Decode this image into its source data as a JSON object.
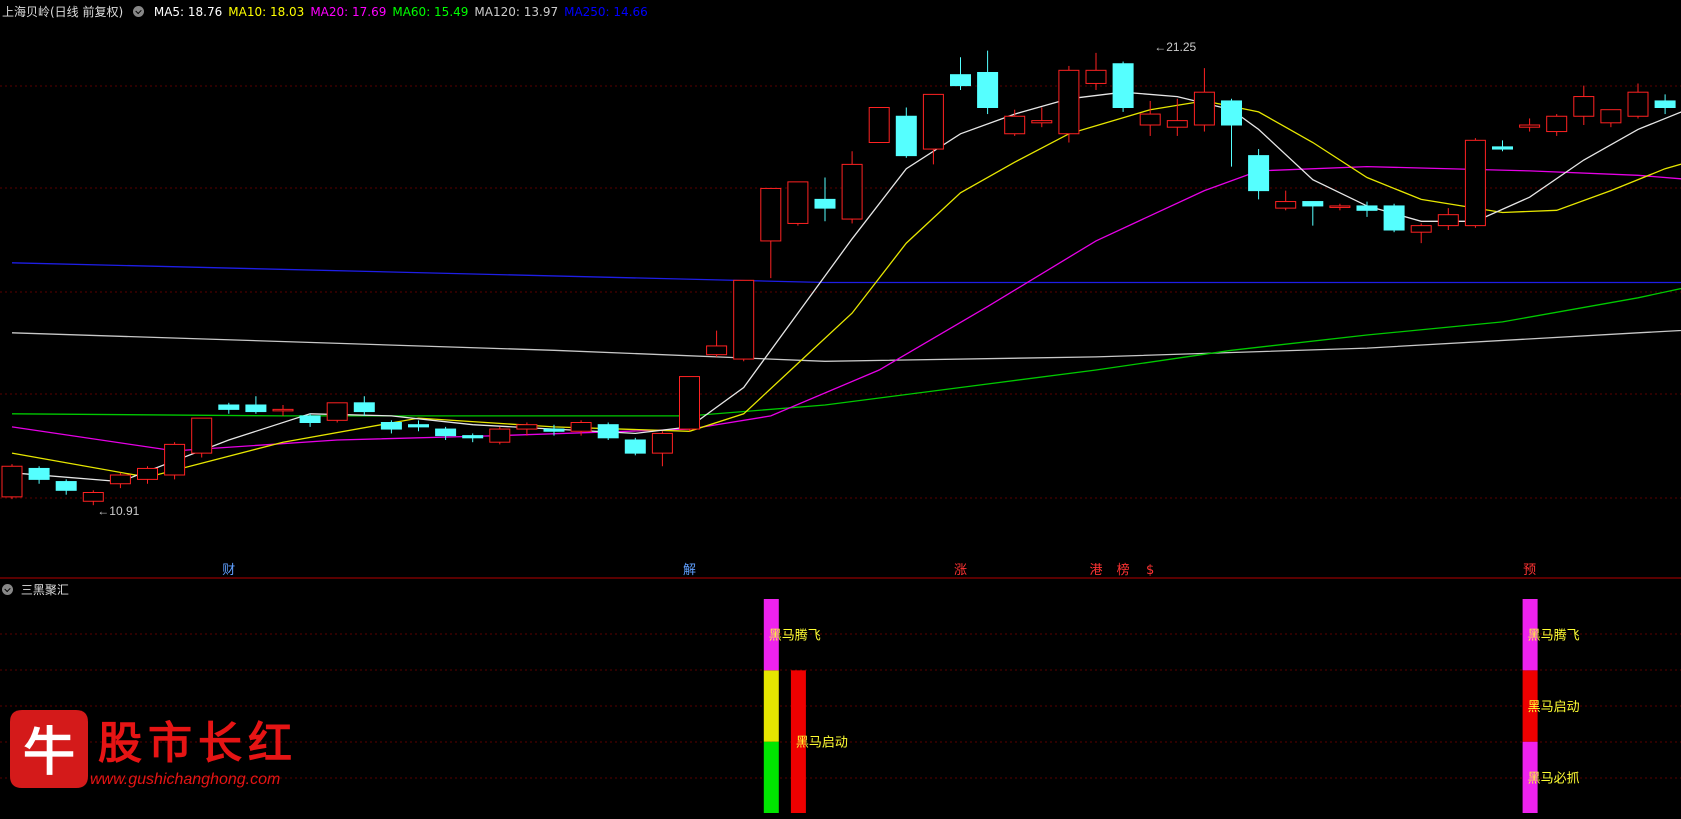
{
  "header": {
    "title": "上海贝岭(日线 前复权)",
    "ma_labels": [
      {
        "text": "MA5: 18.76",
        "color": "#ffffff"
      },
      {
        "text": "MA10: 18.03",
        "color": "#ffff00"
      },
      {
        "text": "MA20: 17.69",
        "color": "#ff00ff"
      },
      {
        "text": "MA60: 15.49",
        "color": "#00ff00"
      },
      {
        "text": "MA120: 13.97",
        "color": "#cccccc"
      },
      {
        "text": "MA250: 14.66",
        "color": "#0000ff"
      }
    ]
  },
  "subchart_title": "三黑聚汇",
  "logo": {
    "brand": "股市长红",
    "glyph": "牛",
    "url": "www.gushichanghong.com"
  },
  "chart_data": {
    "type": "candlestick",
    "price_range": [
      10,
      22
    ],
    "colors": {
      "up": "#ff2222",
      "down": "#55ffff",
      "ma5": "#e6e6e6",
      "ma10": "#e6e600",
      "ma20": "#e600e6",
      "ma60": "#00c800",
      "ma120": "#c8c8c8",
      "ma250": "#1e1ee6"
    },
    "candles": [
      [
        11.1,
        11.8,
        11.05,
        11.85
      ],
      [
        11.75,
        11.5,
        11.4,
        11.8
      ],
      [
        11.45,
        11.25,
        11.15,
        11.5
      ],
      [
        11.0,
        11.2,
        10.91,
        11.25
      ],
      [
        11.4,
        11.6,
        11.3,
        11.65
      ],
      [
        11.5,
        11.75,
        11.4,
        11.8
      ],
      [
        11.6,
        12.3,
        11.5,
        12.35
      ],
      [
        12.1,
        12.9,
        12.0,
        12.9
      ],
      [
        13.2,
        13.1,
        13.0,
        13.25
      ],
      [
        13.2,
        13.05,
        13.0,
        13.4
      ],
      [
        13.1,
        13.1,
        12.95,
        13.2
      ],
      [
        12.95,
        12.8,
        12.7,
        13.0
      ],
      [
        12.85,
        13.25,
        12.8,
        13.25
      ],
      [
        13.25,
        13.05,
        12.95,
        13.4
      ],
      [
        12.8,
        12.65,
        12.55,
        12.85
      ],
      [
        12.75,
        12.7,
        12.6,
        12.85
      ],
      [
        12.65,
        12.5,
        12.4,
        12.7
      ],
      [
        12.5,
        12.45,
        12.35,
        12.55
      ],
      [
        12.35,
        12.65,
        12.3,
        12.7
      ],
      [
        12.65,
        12.75,
        12.5,
        12.8
      ],
      [
        12.65,
        12.6,
        12.5,
        12.75
      ],
      [
        12.6,
        12.8,
        12.5,
        12.85
      ],
      [
        12.75,
        12.45,
        12.4,
        12.8
      ],
      [
        12.4,
        12.1,
        12.05,
        12.45
      ],
      [
        12.1,
        12.55,
        11.8,
        12.6
      ],
      [
        12.65,
        13.85,
        12.6,
        13.85
      ],
      [
        14.35,
        14.55,
        14.3,
        14.9
      ],
      [
        14.25,
        16.05,
        14.2,
        16.05
      ],
      [
        16.95,
        18.15,
        16.1,
        18.15
      ],
      [
        17.35,
        18.3,
        17.3,
        18.3
      ],
      [
        17.9,
        17.7,
        17.4,
        18.4
      ],
      [
        17.45,
        18.7,
        17.35,
        19.0
      ],
      [
        19.2,
        20.0,
        19.2,
        20.0
      ],
      [
        19.8,
        18.9,
        18.85,
        20.0
      ],
      [
        19.05,
        20.3,
        18.7,
        20.3
      ],
      [
        20.75,
        20.5,
        20.4,
        21.15
      ],
      [
        20.8,
        20.0,
        19.85,
        21.3
      ],
      [
        19.4,
        19.8,
        19.35,
        19.95
      ],
      [
        19.65,
        19.7,
        19.55,
        20.0
      ],
      [
        19.4,
        20.85,
        19.2,
        20.95
      ],
      [
        20.55,
        20.85,
        20.4,
        21.25
      ],
      [
        21.0,
        20.0,
        19.9,
        21.05
      ],
      [
        19.6,
        19.85,
        19.35,
        20.15
      ],
      [
        19.55,
        19.7,
        19.35,
        20.2
      ],
      [
        19.6,
        20.35,
        19.45,
        20.9
      ],
      [
        20.15,
        19.6,
        18.65,
        20.2
      ],
      [
        18.9,
        18.1,
        17.9,
        19.05
      ],
      [
        17.7,
        17.85,
        17.65,
        18.1
      ],
      [
        17.85,
        17.75,
        17.3,
        17.85
      ],
      [
        17.75,
        17.75,
        17.65,
        17.8
      ],
      [
        17.75,
        17.65,
        17.5,
        17.85
      ],
      [
        17.75,
        17.2,
        17.15,
        17.8
      ],
      [
        17.15,
        17.3,
        16.9,
        17.35
      ],
      [
        17.3,
        17.55,
        17.2,
        17.7
      ],
      [
        17.3,
        19.25,
        17.25,
        19.3
      ],
      [
        19.1,
        19.05,
        19.0,
        19.25
      ],
      [
        19.55,
        19.6,
        19.45,
        19.75
      ],
      [
        19.45,
        19.8,
        19.35,
        19.85
      ],
      [
        19.8,
        20.25,
        19.6,
        20.5
      ],
      [
        19.65,
        19.95,
        19.55,
        19.95
      ],
      [
        19.8,
        20.35,
        19.75,
        20.55
      ],
      [
        20.15,
        20.0,
        19.85,
        20.3
      ]
    ],
    "ma120_series": [
      [
        0,
        14.85
      ],
      [
        20,
        14.45
      ],
      [
        30,
        14.2
      ],
      [
        40,
        14.3
      ],
      [
        50,
        14.5
      ],
      [
        60,
        14.85
      ],
      [
        63,
        14.95
      ]
    ],
    "ma250_series": [
      [
        0,
        16.45
      ],
      [
        30,
        16.0
      ],
      [
        40,
        16.0
      ],
      [
        50,
        16.0
      ],
      [
        63,
        16.0
      ]
    ],
    "ma60_series": [
      [
        0,
        13.0
      ],
      [
        10,
        12.95
      ],
      [
        25,
        12.95
      ],
      [
        30,
        13.2
      ],
      [
        35,
        13.6
      ],
      [
        40,
        14.0
      ],
      [
        45,
        14.45
      ],
      [
        50,
        14.8
      ],
      [
        55,
        15.1
      ],
      [
        60,
        15.65
      ],
      [
        63,
        16.05
      ]
    ],
    "ma20_series": [
      [
        0,
        12.7
      ],
      [
        6,
        12.15
      ],
      [
        12,
        12.4
      ],
      [
        18,
        12.5
      ],
      [
        25,
        12.65
      ],
      [
        28,
        12.95
      ],
      [
        32,
        14.0
      ],
      [
        36,
        15.45
      ],
      [
        40,
        16.95
      ],
      [
        44,
        18.1
      ],
      [
        46,
        18.55
      ],
      [
        50,
        18.65
      ],
      [
        56,
        18.55
      ],
      [
        60,
        18.45
      ],
      [
        63,
        18.3
      ]
    ],
    "ma10_series": [
      [
        0,
        12.1
      ],
      [
        5,
        11.55
      ],
      [
        10,
        12.35
      ],
      [
        15,
        12.9
      ],
      [
        20,
        12.7
      ],
      [
        25,
        12.6
      ],
      [
        27,
        13.0
      ],
      [
        29,
        14.15
      ],
      [
        31,
        15.3
      ],
      [
        33,
        16.9
      ],
      [
        35,
        18.05
      ],
      [
        37,
        18.75
      ],
      [
        39,
        19.4
      ],
      [
        42,
        19.95
      ],
      [
        44,
        20.15
      ],
      [
        46,
        19.9
      ],
      [
        48,
        19.2
      ],
      [
        50,
        18.4
      ],
      [
        52,
        17.9
      ],
      [
        55,
        17.6
      ],
      [
        57,
        17.65
      ],
      [
        59,
        18.1
      ],
      [
        61,
        18.6
      ],
      [
        63,
        18.95
      ]
    ],
    "ma5_series": [
      [
        0,
        11.65
      ],
      [
        4,
        11.45
      ],
      [
        8,
        12.4
      ],
      [
        11,
        13.0
      ],
      [
        14,
        12.95
      ],
      [
        17,
        12.75
      ],
      [
        20,
        12.65
      ],
      [
        23,
        12.55
      ],
      [
        25,
        12.7
      ],
      [
        27,
        13.6
      ],
      [
        29,
        15.3
      ],
      [
        31,
        17.0
      ],
      [
        33,
        18.6
      ],
      [
        35,
        19.4
      ],
      [
        37,
        19.85
      ],
      [
        39,
        20.2
      ],
      [
        41,
        20.35
      ],
      [
        43,
        20.25
      ],
      [
        45,
        19.95
      ],
      [
        46,
        19.5
      ],
      [
        48,
        18.35
      ],
      [
        50,
        17.75
      ],
      [
        52,
        17.4
      ],
      [
        54,
        17.4
      ],
      [
        56,
        17.95
      ],
      [
        58,
        18.8
      ],
      [
        60,
        19.5
      ],
      [
        62,
        20.0
      ],
      [
        63,
        20.1
      ]
    ],
    "annotations": [
      {
        "index": 42,
        "value": 21.25,
        "text": "21.25",
        "pos": "high"
      },
      {
        "index": 3,
        "value": 10.91,
        "text": "10.91",
        "pos": "low"
      }
    ],
    "markers": [
      {
        "index": 8,
        "text": "财",
        "color": "#5f9fff"
      },
      {
        "index": 25,
        "text": "解",
        "color": "#5f9fff"
      },
      {
        "index": 35,
        "text": "涨",
        "color": "#ff3333"
      },
      {
        "index": 40,
        "text": "港",
        "color": "#ff3333"
      },
      {
        "index": 41,
        "text": "榜",
        "color": "#ff3333"
      },
      {
        "index": 42,
        "text": "$",
        "color": "#ff3333"
      },
      {
        "index": 56,
        "text": "预",
        "color": "#ff3333"
      }
    ],
    "signals": [
      {
        "index": 28,
        "segments": [
          {
            "from": 0.0,
            "to": 0.4,
            "color": "#00e600",
            "label": ""
          },
          {
            "from": 0.4,
            "to": 0.8,
            "color": "#e6e600",
            "label": ""
          },
          {
            "from": 0.8,
            "to": 1.2,
            "color": "#ee22ee",
            "label": "黑马腾飞"
          }
        ]
      },
      {
        "index": 29,
        "segments": [
          {
            "from": 0.0,
            "to": 0.8,
            "color": "#ee0000",
            "label": "黑马启动"
          }
        ]
      },
      {
        "index": 56,
        "segments": [
          {
            "from": 0.0,
            "to": 0.4,
            "color": "#ee22ee",
            "label": "黑马必抓"
          },
          {
            "from": 0.4,
            "to": 0.8,
            "color": "#ee0000",
            "label": "黑马启动"
          },
          {
            "from": 0.8,
            "to": 1.2,
            "color": "#ee22ee",
            "label": "黑马腾飞"
          }
        ]
      }
    ]
  }
}
